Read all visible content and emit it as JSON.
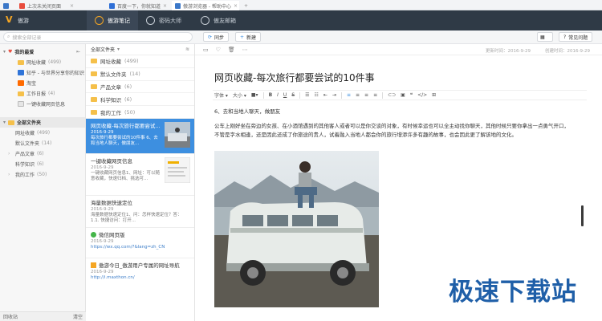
{
  "browser_tabs": [
    {
      "label": "上次未关闭页面",
      "color": "#e84c3d",
      "active": false
    },
    {
      "label": "百度一下，你就知道",
      "color": "#2f6fd6",
      "active": false
    },
    {
      "label": "傲游浏览器 - 帮助中心",
      "color": "#3a77c8",
      "active": false
    }
  ],
  "app": {
    "logo_text": "V",
    "name": "傲游",
    "tabs": [
      {
        "label": "傲游笔记",
        "icon": "leaf-icon"
      },
      {
        "label": "密码大师",
        "icon": "fingerprint-icon"
      },
      {
        "label": "傲友邮箱",
        "icon": "mail-icon"
      }
    ]
  },
  "toolbar": {
    "search_placeholder": "搜索全部记录",
    "sync_label": "同步",
    "new_label": "新建",
    "help_label": "常见问题"
  },
  "sidebar": {
    "favorites_label": "我的最爱",
    "favorites": [
      {
        "label": "网址收藏",
        "count": "(499)",
        "icon": "folder-icon"
      },
      {
        "label": "知乎 - 与世界分享你的知识",
        "count": "",
        "icon": "zhihu-icon"
      },
      {
        "label": "淘宝",
        "count": "",
        "icon": "taobao-icon"
      },
      {
        "label": "工作日报",
        "count": "(4)",
        "icon": "folder-icon"
      },
      {
        "label": "一键收藏网页信息",
        "count": "",
        "icon": "note-icon"
      }
    ],
    "all_folders_label": "全部文件夹",
    "folders": [
      {
        "label": "网址收藏",
        "count": "(499)"
      },
      {
        "label": "默认文件夹",
        "count": "(14)"
      },
      {
        "label": "产品文章",
        "count": "(6)"
      },
      {
        "label": "科学知识",
        "count": "(6)"
      },
      {
        "label": "我的工作",
        "count": "(50)"
      }
    ],
    "footer_left": "回收站",
    "footer_right": "清空"
  },
  "middle": {
    "header": "全部文件夹",
    "folders": [
      {
        "label": "网址收藏",
        "count": "(499)"
      },
      {
        "label": "默认文件夹",
        "count": "(14)"
      },
      {
        "label": "产品文章",
        "count": "(6)"
      },
      {
        "label": "科学知识",
        "count": "(6)"
      },
      {
        "label": "我的工作",
        "count": "(50)"
      }
    ],
    "notes": [
      {
        "title": "网页收藏-每次旅行都要尝试...",
        "date": "2016-9-29",
        "snippet": "每次旅行都要尝试的10件事 6、去和当地人聊天，做朋友...",
        "selected": true
      },
      {
        "title": "一键收藏网页信息",
        "date": "2016-9-29",
        "snippet": "一键收藏网页信息1、网址：可以随意收藏，快速归档、挑选可..."
      },
      {
        "title": "海量数据快速定位",
        "date": "2016-9-29",
        "snippet": "海量数据快速定位1、问：怎样快速定位？答：1.1. 快捷访问：打开..."
      },
      {
        "title": "微信网页版",
        "date": "2016-9-29",
        "snippet": "https://wx.qq.com/?&lang=zh_CN"
      },
      {
        "title": "傲游今日_傲游用户专属的网址导航",
        "date": "2016-9-29",
        "snippet": "http://i.maxthon.cn/"
      }
    ]
  },
  "editor": {
    "updated_label": "更新时间：2016-9-29",
    "created_label": "创建时间：2016-9-29",
    "title": "网页收藏-每次旅行都要尝试的10件事",
    "font_label": "字体",
    "size_label": "大小",
    "heading": "6、去和当地人聊天，做朋友",
    "paragraph1": "公车上刚好坐在旁边的女孩、在小酒馆遇到的其他客人或者可以是你交谈的对象，有时候幸运也可以全主动找你聊天，其他时候只要你拿出一点勇气开口，",
    "paragraph2": "不管是字水相逢，还是因此还成了你旅途的贵人，试着融入当地人都会你的旅行增添许多有趣的故事，也会因此更了解该地的文化。"
  },
  "watermark": "极速下载站"
}
